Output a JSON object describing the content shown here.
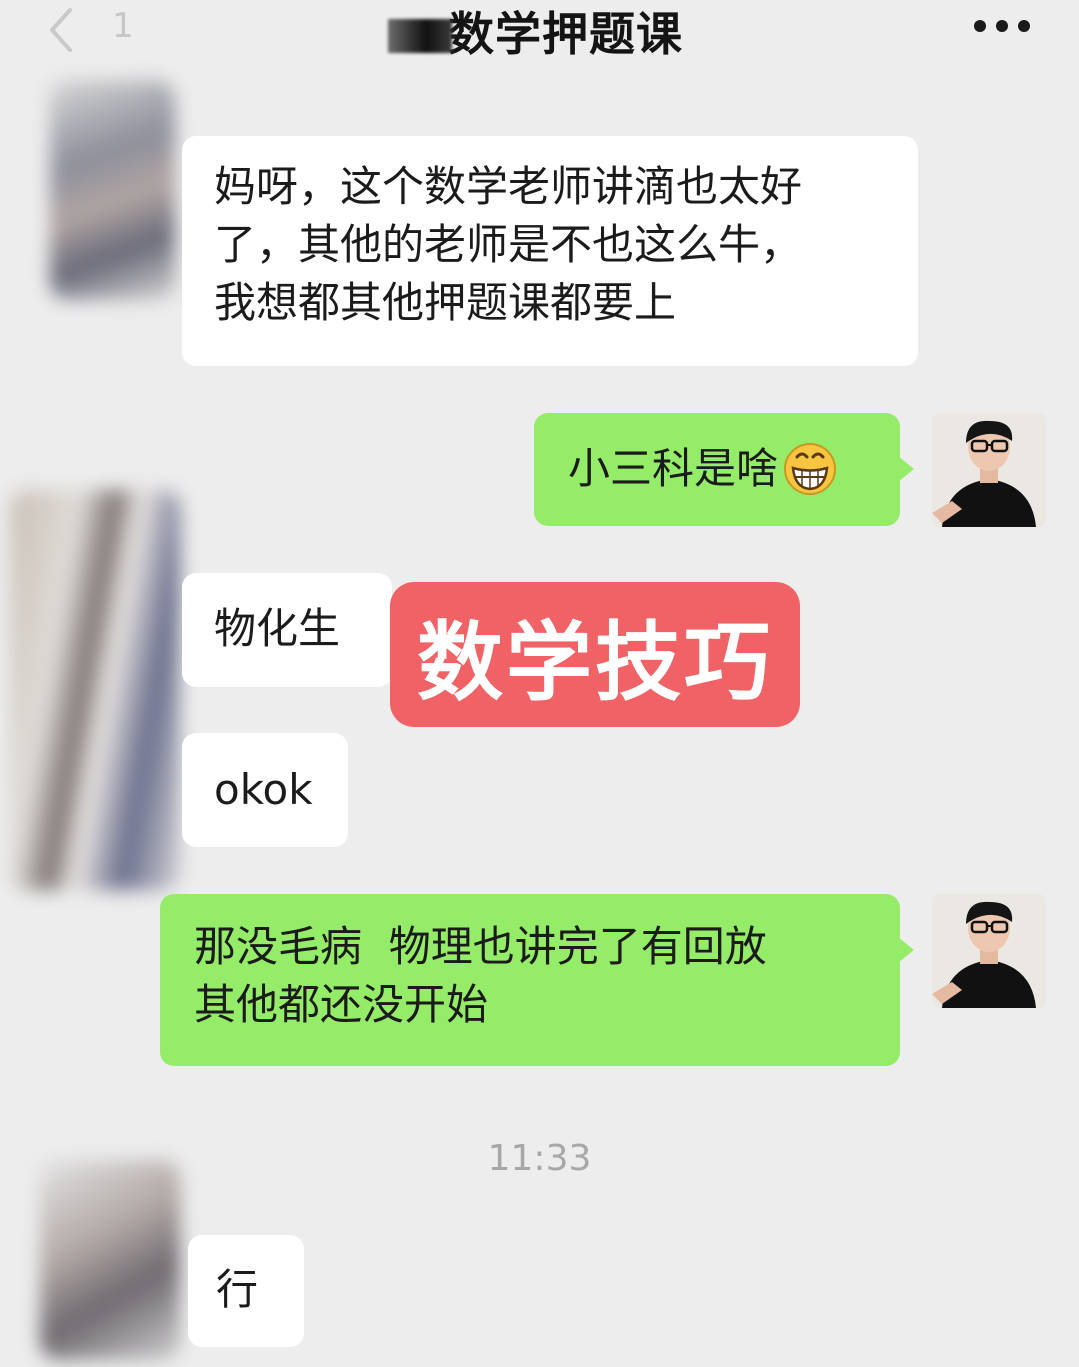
{
  "header": {
    "back_icon": "chevron-left-icon",
    "unread_count": "1",
    "title": "数学押题课",
    "more_icon": "more-dots-icon"
  },
  "messages": [
    {
      "side": "left",
      "text_lines": [
        "妈呀，这个数学老师讲滴也太好",
        "了，其他的老师是不也这么牛，",
        "我想都其他押题课都要上"
      ]
    },
    {
      "side": "right",
      "text": "小三科是啥",
      "emoji": "grinning-face-icon"
    },
    {
      "side": "left",
      "text": "物化生"
    },
    {
      "side": "left",
      "text": "okok"
    },
    {
      "side": "right",
      "text_lines": [
        "那没毛病  物理也讲完了有回放",
        "其他都还没开始"
      ]
    },
    {
      "side": "left",
      "text": "行"
    }
  ],
  "stamp": {
    "text": "数学技巧",
    "color": "#f06265"
  },
  "timestamp": "11:33",
  "colors": {
    "background": "#ededed",
    "bubble_self": "#95ec69",
    "bubble_other": "#ffffff"
  }
}
